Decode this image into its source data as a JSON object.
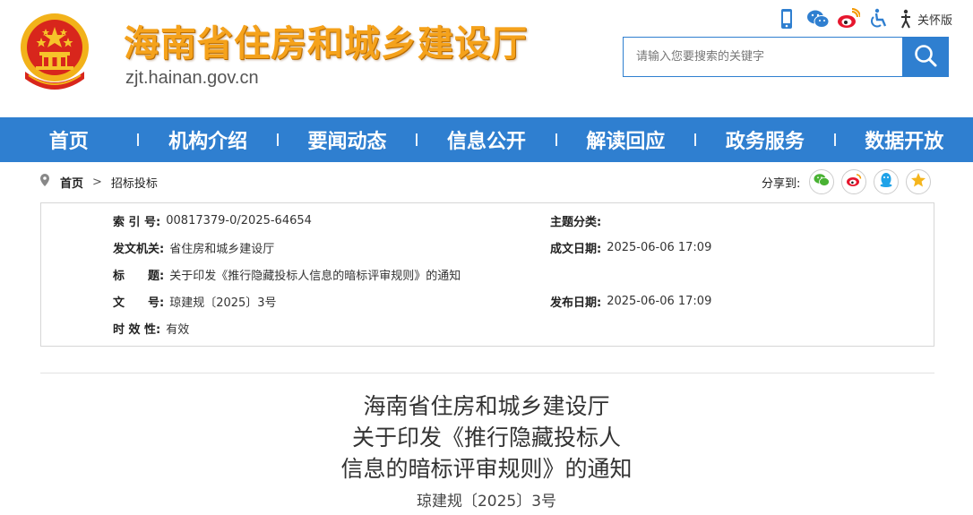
{
  "header": {
    "site_title": "海南省住房和城乡建设厅",
    "site_domain": "zjt.hainan.gov.cn",
    "care_mode_label": "关怀版",
    "tool_icons": [
      "mobile-icon",
      "wechat-icon",
      "weibo-icon",
      "accessibility-icon",
      "care-mode-icon"
    ]
  },
  "search": {
    "placeholder": "请输入您要搜索的关键字"
  },
  "nav": {
    "items": [
      "首页",
      "机构介绍",
      "要闻动态",
      "信息公开",
      "解读回应",
      "政务服务",
      "数据开放"
    ]
  },
  "breadcrumb": {
    "home": "首页",
    "arrow": ">",
    "current": "招标投标"
  },
  "share": {
    "label": "分享到:",
    "icons": [
      "wechat-icon",
      "weibo-icon",
      "qq-icon",
      "qzone-icon"
    ]
  },
  "meta": {
    "index_label": "索 引 号:",
    "index_value": "00817379-0/2025-64654",
    "topic_label": "主题分类:",
    "topic_value": "",
    "issuer_label": "发文机关:",
    "issuer_value": "省住房和城乡建设厅",
    "created_label": "成文日期:",
    "created_value": "2025-06-06 17:09",
    "title_label": "标　　题:",
    "title_value": "关于印发《推行隐藏投标人信息的暗标评审规则》的通知",
    "docno_label": "文　　号:",
    "docno_value": "琼建规〔2025〕3号",
    "published_label": "发布日期:",
    "published_value": "2025-06-06 17:09",
    "validity_label": "时 效 性:",
    "validity_value": "有效"
  },
  "document": {
    "title_line1": "海南省住房和城乡建设厅",
    "title_line2": "关于印发《推行隐藏投标人",
    "title_line3": "信息的暗标评审规则》的通知",
    "number": "琼建规〔2025〕3号"
  },
  "colors": {
    "brand_blue": "#2f7fd0",
    "title_gold": "#f5a21b",
    "emblem_red": "#d8261c"
  }
}
